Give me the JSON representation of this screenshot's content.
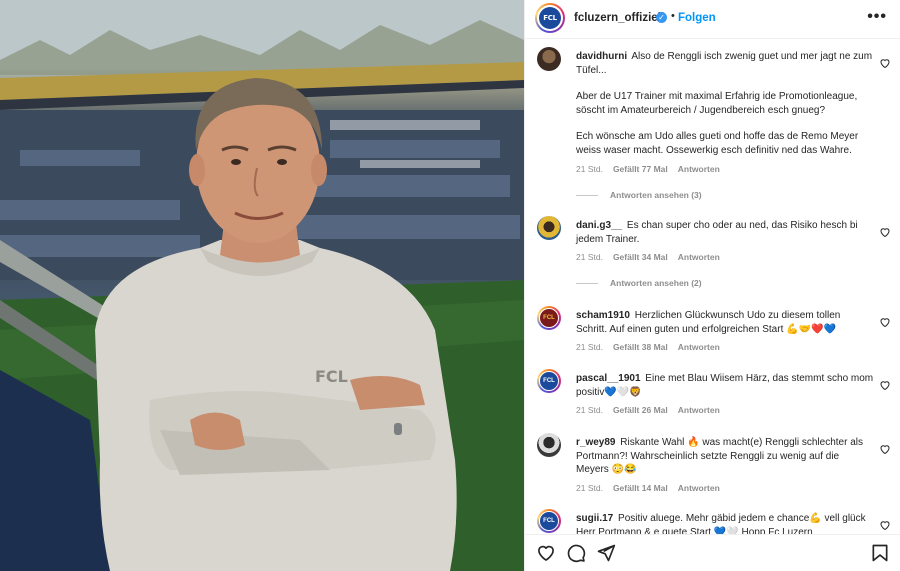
{
  "post": {
    "account": "fcluzern_offiziell",
    "verified_mark": "✓",
    "separator": "•",
    "follow_label": "Folgen",
    "more_label": "•••",
    "avatar_text": "FCL",
    "shirt_logo": "FCL"
  },
  "comments": [
    {
      "user": "davidhurni",
      "paragraphs": [
        "Also de Renggli isch zwenig guet und mer jagt ne zum Tüfel...",
        "Aber de U17 Trainer mit maximal Erfahrig ide Promotionleague, söscht im Amateurbereich / Jugendbereich esch gnueg?",
        "Ech wönsche am Udo alles gueti ond hoffe das de Remo Meyer weiss waser macht. Ossewerkig esch definitiv ned das Wahre."
      ],
      "time": "21 Std.",
      "likes": "Gefällt 77 Mal",
      "reply": "Antworten",
      "view_replies": "Antworten ansehen (3)"
    },
    {
      "user": "dani.g3__",
      "text": "Es chan super cho oder au ned, das Risiko hesch bi jedem Trainer.",
      "time": "21 Std.",
      "likes": "Gefällt 34 Mal",
      "reply": "Antworten",
      "view_replies": "Antworten ansehen (2)"
    },
    {
      "user": "scham1910",
      "text": "Herzlichen Glückwunsch Udo zu diesem tollen Schritt. Auf einen guten und erfolgreichen Start 💪🤝❤️💙",
      "time": "21 Std.",
      "likes": "Gefällt 38 Mal",
      "reply": "Antworten",
      "avatar_text": "FCL"
    },
    {
      "user": "pascal__1901",
      "text": "Eine met Blau Wiisem Härz, das stemmt scho mom positiv💙🤍🦁",
      "time": "21 Std.",
      "likes": "Gefällt 26 Mal",
      "reply": "Antworten",
      "avatar_text": "FCL"
    },
    {
      "user": "r_wey89",
      "text": "Riskante Wahl 🔥 was macht(e) Renggli schlechter als Portmann?! Wahrscheinlich setzte Renggli zu wenig auf die Meyers 😳😂",
      "time": "21 Std.",
      "likes": "Gefällt 14 Mal",
      "reply": "Antworten"
    },
    {
      "user": "sugii.17",
      "text": "Positiv aluege. Mehr gäbid jedem e chance💪 vell glück Herr Portmann & e guete Start 💙🤍 Hopp Fc Luzern",
      "time": "",
      "likes": "",
      "reply": "",
      "avatar_text": "FCL"
    }
  ],
  "actions": {
    "like_icon": "heart-icon",
    "comment_icon": "comment-icon",
    "share_icon": "share-icon",
    "save_icon": "bookmark-icon"
  },
  "colors": {
    "link_blue": "#0095f6",
    "verified_blue": "#3897f0",
    "meta_gray": "#8e8e8e",
    "text": "#262626"
  }
}
